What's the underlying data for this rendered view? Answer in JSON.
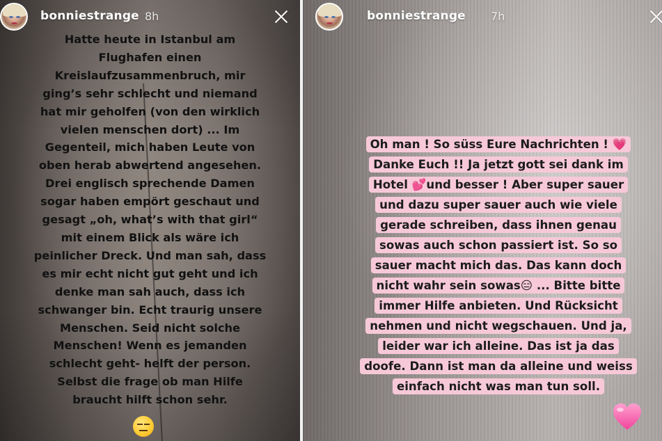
{
  "left_story": {
    "username": "bonniestrange",
    "time_ago": "8h",
    "close_icon": "close-icon",
    "text_lines": [
      "Hatte heute in Istanbul am",
      "Flughafen einen",
      "Kreislaufzusammenbruch, mir",
      "ging’s sehr schlecht und niemand",
      "hat mir geholfen (von den wirklich",
      "vielen menschen dort) ... Im",
      "Gegenteil, mich haben Leute von",
      "oben herab abwertend angesehen.",
      "Drei englisch sprechende Damen",
      "sogar haben empört geschaut und",
      "gesagt „oh, what’s with that girl“",
      "mit einem Blick als wäre ich",
      "peinlicher Dreck. Und man sah, dass",
      "es mir echt nicht gut geht und ich",
      "denke man sah auch, dass ich",
      "schwanger bin. Echt traurig unsere",
      "Menschen.  Seid nicht solche",
      "Menschen! Wenn es jemanden",
      "schlecht geht- helft der person.",
      "Selbst die frage ob man Hilfe",
      "braucht hilft schon sehr."
    ],
    "emoji": "expressionless-face-emoji"
  },
  "right_story": {
    "username": "bonniestrange",
    "time_ago": "7h",
    "close_icon": "close-icon",
    "highlight_color": "#f7c9d8",
    "text_lines": [
      "Oh man ! So süss Eure Nachrichten ! 💗",
      "Danke Euch !! Ja jetzt gott sei dank im",
      "Hotel 💕und besser ! Aber super sauer",
      "und dazu super sauer auch wie viele",
      "gerade schreiben, dass ihnen genau",
      "sowas auch schon passiert ist. So so",
      "sauer macht mich das. Das kann doch",
      "nicht wahr sein sowas😑 ... Bitte bitte",
      "immer Hilfe anbieten. Und Rücksicht",
      "nehmen und nicht wegschauen. Und ja,",
      "leider war ich alleine. Das ist ja das",
      "doofe. Dann ist man da alleine und weiss",
      "einfach nicht was man tun soll."
    ],
    "emoji": "pink-heart-emoji"
  }
}
